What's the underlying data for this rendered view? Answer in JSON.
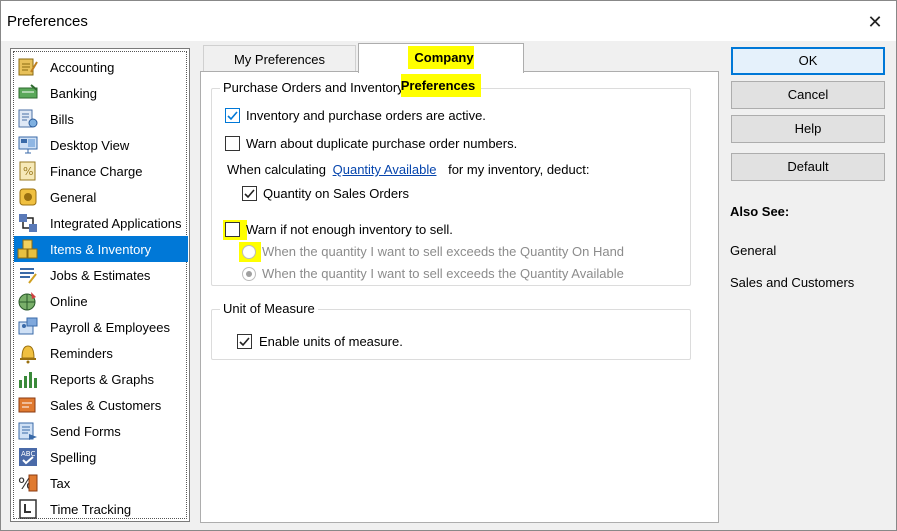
{
  "window": {
    "title": "Preferences"
  },
  "categories": [
    {
      "label": "Accounting",
      "icon": "accounting-icon"
    },
    {
      "label": "Banking",
      "icon": "banking-icon"
    },
    {
      "label": "Bills",
      "icon": "bills-icon"
    },
    {
      "label": "Desktop View",
      "icon": "desktop-view-icon"
    },
    {
      "label": "Finance Charge",
      "icon": "finance-charge-icon"
    },
    {
      "label": "General",
      "icon": "general-icon"
    },
    {
      "label": "Integrated Applications",
      "icon": "integrated-apps-icon"
    },
    {
      "label": "Items & Inventory",
      "icon": "items-inventory-icon"
    },
    {
      "label": "Jobs & Estimates",
      "icon": "jobs-estimates-icon"
    },
    {
      "label": "Online",
      "icon": "online-icon"
    },
    {
      "label": "Payroll & Employees",
      "icon": "payroll-icon"
    },
    {
      "label": "Reminders",
      "icon": "reminders-icon"
    },
    {
      "label": "Reports & Graphs",
      "icon": "reports-graphs-icon"
    },
    {
      "label": "Sales & Customers",
      "icon": "sales-customers-icon"
    },
    {
      "label": "Send Forms",
      "icon": "send-forms-icon"
    },
    {
      "label": "Spelling",
      "icon": "spelling-icon"
    },
    {
      "label": "Tax",
      "icon": "tax-icon"
    },
    {
      "label": "Time Tracking",
      "icon": "time-tracking-icon"
    }
  ],
  "selected_category": "Items & Inventory",
  "tabs": {
    "mine": "My Preferences",
    "company": "Company Preferences",
    "active": "Company Preferences"
  },
  "purchase_orders": {
    "title": "Purchase Orders and Inventory",
    "inventory_active": {
      "label": "Inventory and purchase orders are active.",
      "checked": true
    },
    "warn_duplicate": {
      "label": "Warn about duplicate purchase order numbers.",
      "checked": false
    },
    "calc_prefix": "When calculating",
    "calc_link": "Quantity Available",
    "calc_suffix": "for my inventory, deduct:",
    "qty_sales_orders": {
      "label": "Quantity on Sales Orders",
      "checked": true
    },
    "warn_not_enough": {
      "label": "Warn if not enough inventory to sell.",
      "checked": false
    },
    "radio_on_hand": {
      "label": "When the quantity I want to sell exceeds the Quantity On Hand",
      "selected": false
    },
    "radio_available": {
      "label": "When the quantity I want to sell exceeds the Quantity Available",
      "selected": true
    }
  },
  "unit_of_measure": {
    "title": "Unit of Measure",
    "enable": {
      "label": "Enable units of measure.",
      "checked": true
    }
  },
  "buttons": {
    "ok": "OK",
    "cancel": "Cancel",
    "help": "Help",
    "default": "Default"
  },
  "also_see": {
    "title": "Also See:",
    "links": [
      "General",
      "Sales and Customers"
    ]
  },
  "colors": {
    "selection": "#0078d7",
    "highlight": "#ffff00",
    "link": "#0645ad"
  }
}
